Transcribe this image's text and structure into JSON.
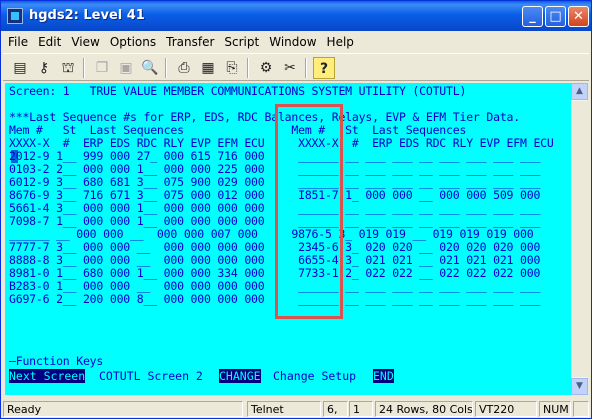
{
  "window": {
    "title": "hgds2: Level 41"
  },
  "menu": [
    "File",
    "Edit",
    "View",
    "Options",
    "Transfer",
    "Script",
    "Window",
    "Help"
  ],
  "toolbar_icons": [
    "new-session-icon",
    "connect-icon",
    "disconnect-icon",
    "copy-icon",
    "paste-icon",
    "find-icon",
    "print-screen-icon",
    "print-setup-icon",
    "print-icon",
    "settings-icon",
    "tools-icon",
    "help-icon"
  ],
  "terminal": {
    "lines": [
      "Screen: 1   TRUE VALUE MEMBER COMMUNICATIONS SYSTEM UTILITY (COTUTL)",
      "",
      "***Last Sequence #s for ERP, EDS, RDC Balances, Relays, EVP & EFM Tier Data.",
      "Mem #   St  Last Sequences                Mem #   St  Last Sequences",
      "XXXX-X  #  ERP EDS RDC RLY EVP EFM ECU     XXXX-X  #  ERP EDS RDC RLY EVP EFM ECU",
      "2012-9 1__ 999 000 27_ 000 615 716 000     ______ __ ___ ___ __ ___ ___ ___ ___",
      "0103-2 2__ 000 000 1__ 000 000 225 000     ______ __ ___ ___ __ ___ ___ ___ ___",
      "6012-9 3__ 680 681 3__ 075 900 029 000     ______ __ ___ ___ __ ___ ___ ___ ___",
      "8676-9 3__ 716 671 3__ 075 000 012 000     I851-7 1_ 000 000 __ 000 000 509 000",
      "5661-4 3__ 000 000 1__ 000 000 000 000     ______ __ ___ ___ __ ___ ___ ___ ___",
      "7098-7 1__ 000 000 1__ 000 000 000 000     ______ __ ___ ___ __ ___ ___ ___ ___",
      "______ __ 000 000 __  000 000 007 000     9876-5 3_ 019 019 __ 019 019 019 000",
      "7777-7 3__ 000 000 __  000 000 000 000     2345-6 3_ 020 020 __ 020 020 020 000",
      "8888-8 3__ 000 000 __  000 000 000 000     6655-4 3_ 021 021 __ 021 021 021 000",
      "8981-0 1__ 680 000 1__ 000 000 334 000     7733-1 2_ 022 022 __ 022 022 022 000",
      "B283-0 1__ 000 000 __  000 000 000 000     ______ __ ___ ___ __ ___ ___ ___ ___",
      "G697-6 2__ 200 000 8__ 000 000 000 000     ______ __ ___ ___ __ ___ ___ ___ ___",
      "",
      "",
      "",
      "",
      "—Function Keys"
    ],
    "fkeys": {
      "next_screen": "Next Screen",
      "next_screen_desc": "COTUTL Screen 2",
      "change": "CHANGE",
      "change_desc": "Change Setup",
      "end": "END"
    }
  },
  "status": {
    "left": "Ready",
    "protocol": "Telnet",
    "row": "6,",
    "col": "1",
    "size": "24 Rows, 80 Cols",
    "emulation": "VT220",
    "keylock": "NUM"
  }
}
